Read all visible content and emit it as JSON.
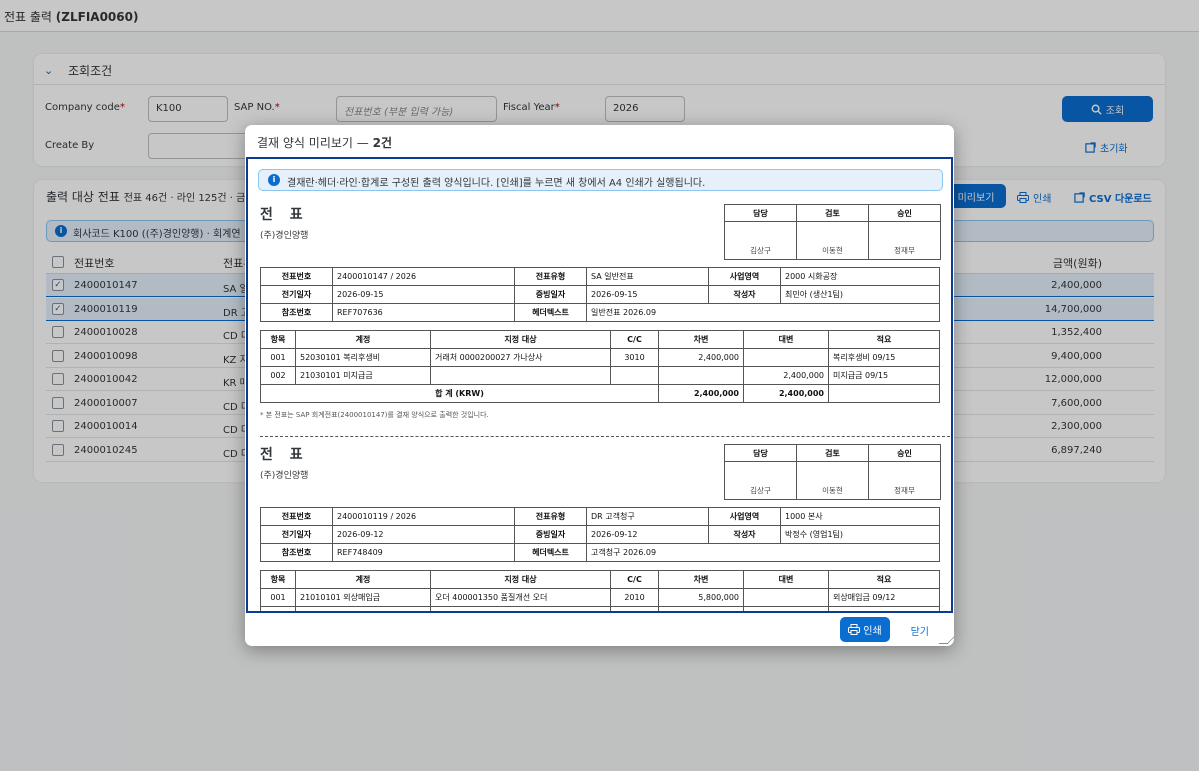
{
  "app": {
    "title_prefix": "전표 출력 ",
    "title_code": "(ZLFIA0060)"
  },
  "filter": {
    "section_title": "조회조건",
    "company_code_label": "Company code",
    "company_code_value": "K100",
    "sap_no_label": "SAP NO.",
    "sap_no_placeholder": "전표번호 (부분 입력 가능)",
    "fiscal_year_label": "Fiscal Year",
    "fiscal_year_value": "2026",
    "create_by_label": "Create By",
    "search_button": "조회",
    "reset_button": "초기화"
  },
  "table": {
    "title": "출력 대상 전표",
    "summary": "전표 46건 · 라인 125건 · 금",
    "banner": "회사코드 K100 ((주)경인양행) · 회계연",
    "preview_button": "미리보기",
    "print_button": "인쇄",
    "csv_button": "CSV 다운로드",
    "col_doc_no": "전표번호",
    "col_doc_type": "전표유",
    "col_amount": "금액(원화)",
    "rows": [
      {
        "doc_no": "2400010147",
        "type": "SA 일",
        "amount": "2,400,000",
        "checked": true
      },
      {
        "doc_no": "2400010119",
        "type": "DR 고",
        "amount": "14,700,000",
        "checked": true
      },
      {
        "doc_no": "2400010028",
        "type": "CD 다",
        "amount": "1,352,400",
        "checked": false
      },
      {
        "doc_no": "2400010098",
        "type": "KZ 지",
        "amount": "9,400,000",
        "checked": false
      },
      {
        "doc_no": "2400010042",
        "type": "KR 매",
        "amount": "12,000,000",
        "checked": false
      },
      {
        "doc_no": "2400010007",
        "type": "CD 다",
        "amount": "7,600,000",
        "checked": false
      },
      {
        "doc_no": "2400010014",
        "type": "CD 다",
        "amount": "2,300,000",
        "checked": false
      },
      {
        "doc_no": "2400010245",
        "type": "CD 다",
        "amount": "6,897,240",
        "checked": false
      }
    ]
  },
  "dialog": {
    "title": "결재 양식 미리보기 — ",
    "count": "2건",
    "info": "결재란·헤더·라인·합계로 구성된 출력 양식입니다. [인쇄]를 누르면 새 창에서 A4 인쇄가 실행됩니다.",
    "print_button": "인쇄",
    "close_button": "닫기",
    "doc_title": "전 표",
    "company": "(주)경인양행",
    "approval_headers": [
      "담당",
      "검토",
      "승인"
    ],
    "approval_names": [
      "김상구",
      "이동현",
      "정재무"
    ],
    "hdr_labels": {
      "doc_no": "전표번호",
      "doc_type": "전표유형",
      "biz_area": "사업영역",
      "post_date": "전기일자",
      "doc_date": "증빙일자",
      "author": "작성자",
      "ref_no": "참조번호",
      "header_text": "헤더텍스트"
    },
    "line_headers": [
      "항목",
      "계정",
      "지정 대상",
      "C/C",
      "차변",
      "대변",
      "적요"
    ],
    "total_label": "합 계 (KRW)",
    "doc1": {
      "doc_no": "2400010147 / 2026",
      "doc_type": "SA 일반전표",
      "biz_area": "2000 시화공장",
      "post_date": "2026-09-15",
      "doc_date": "2026-09-15",
      "author": "최민아 (생산1팀)",
      "ref_no": "REF707636",
      "header_text": "일반전표 2026.09",
      "lines": [
        {
          "item": "001",
          "account": "52030101 복리후생비",
          "assign": "거래처 0000200027 가나상사",
          "cc": "3010",
          "debit": "2,400,000",
          "credit": "",
          "memo": "복리후생비 09/15"
        },
        {
          "item": "002",
          "account": "21030101 미지급금",
          "assign": "",
          "cc": "",
          "debit": "",
          "credit": "2,400,000",
          "memo": "미지급금 09/15"
        }
      ],
      "total_debit": "2,400,000",
      "total_credit": "2,400,000",
      "note": "* 본 전표는 SAP 회계전표(2400010147)를 결재 양식으로 출력한 것입니다."
    },
    "doc2": {
      "doc_no": "2400010119 / 2026",
      "doc_type": "DR 고객청구",
      "biz_area": "1000 본사",
      "post_date": "2026-09-12",
      "doc_date": "2026-09-12",
      "author": "박정수 (영업1팀)",
      "ref_no": "REF748409",
      "header_text": "고객청구 2026.09",
      "lines": [
        {
          "item": "001",
          "account": "21010101 외상매입금",
          "assign": "오더 400001350 품질개선 오더",
          "cc": "2010",
          "debit": "5,800,000",
          "credit": "",
          "memo": "외상매입금 09/12"
        }
      ]
    }
  }
}
